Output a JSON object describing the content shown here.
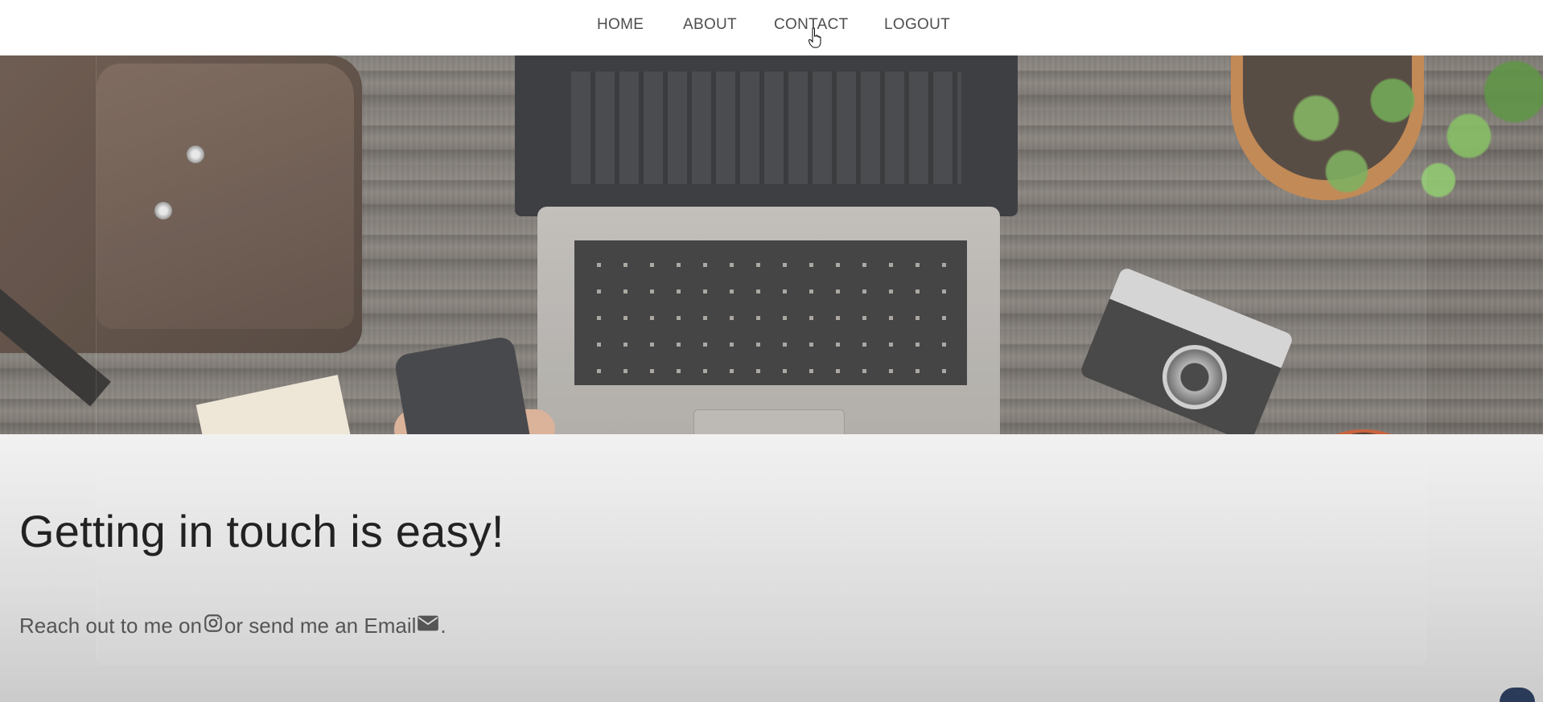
{
  "nav": {
    "items": [
      {
        "label": "HOME"
      },
      {
        "label": "ABOUT"
      },
      {
        "label": "CONTACT"
      },
      {
        "label": "LOGOUT"
      }
    ]
  },
  "content": {
    "headline": "Getting in touch is easy!",
    "reach_prefix": "Reach out to me on",
    "reach_middle": "or send me an Email",
    "reach_suffix": ".",
    "icons": [
      "instagram-icon",
      "email-icon"
    ]
  },
  "colors": {
    "nav_text": "#444444",
    "headline": "#222222",
    "body_text": "#555555",
    "page_bottom": "#cbcbcb"
  }
}
